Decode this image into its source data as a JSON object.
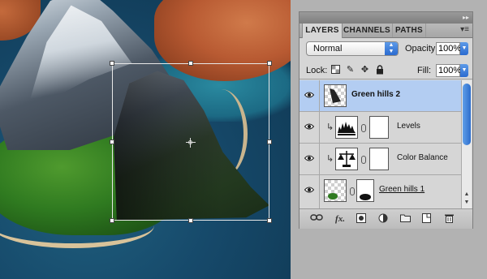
{
  "panel": {
    "tabs": [
      {
        "label": "LAYERS",
        "active": true
      },
      {
        "label": "CHANNELS",
        "active": false
      },
      {
        "label": "PATHS",
        "active": false
      }
    ],
    "blend_mode": "Normal",
    "opacity_label": "Opacity:",
    "opacity_value": "100%",
    "lock_label": "Lock:",
    "fill_label": "Fill:",
    "fill_value": "100%",
    "layers": [
      {
        "name": "Green hills 2",
        "visible": true,
        "selected": true,
        "type": "pixel"
      },
      {
        "name": "Levels",
        "visible": true,
        "selected": false,
        "type": "adjustment",
        "clipped": true
      },
      {
        "name": "Color Balance",
        "visible": true,
        "selected": false,
        "type": "adjustment",
        "clipped": true
      },
      {
        "name": "Green hills 1",
        "visible": true,
        "selected": false,
        "type": "pixel-with-mask"
      }
    ]
  },
  "colors": {
    "selection_highlight": "#b3cdf2",
    "accent_blue": "#2a6ad0",
    "panel_bg": "#d6d6d6",
    "workspace_bg": "#b2b2b2"
  },
  "footer_icons": [
    "link-layers-icon",
    "fx-icon",
    "add-mask-icon",
    "adjustment-layer-icon",
    "new-group-icon",
    "new-layer-icon",
    "trash-icon"
  ]
}
